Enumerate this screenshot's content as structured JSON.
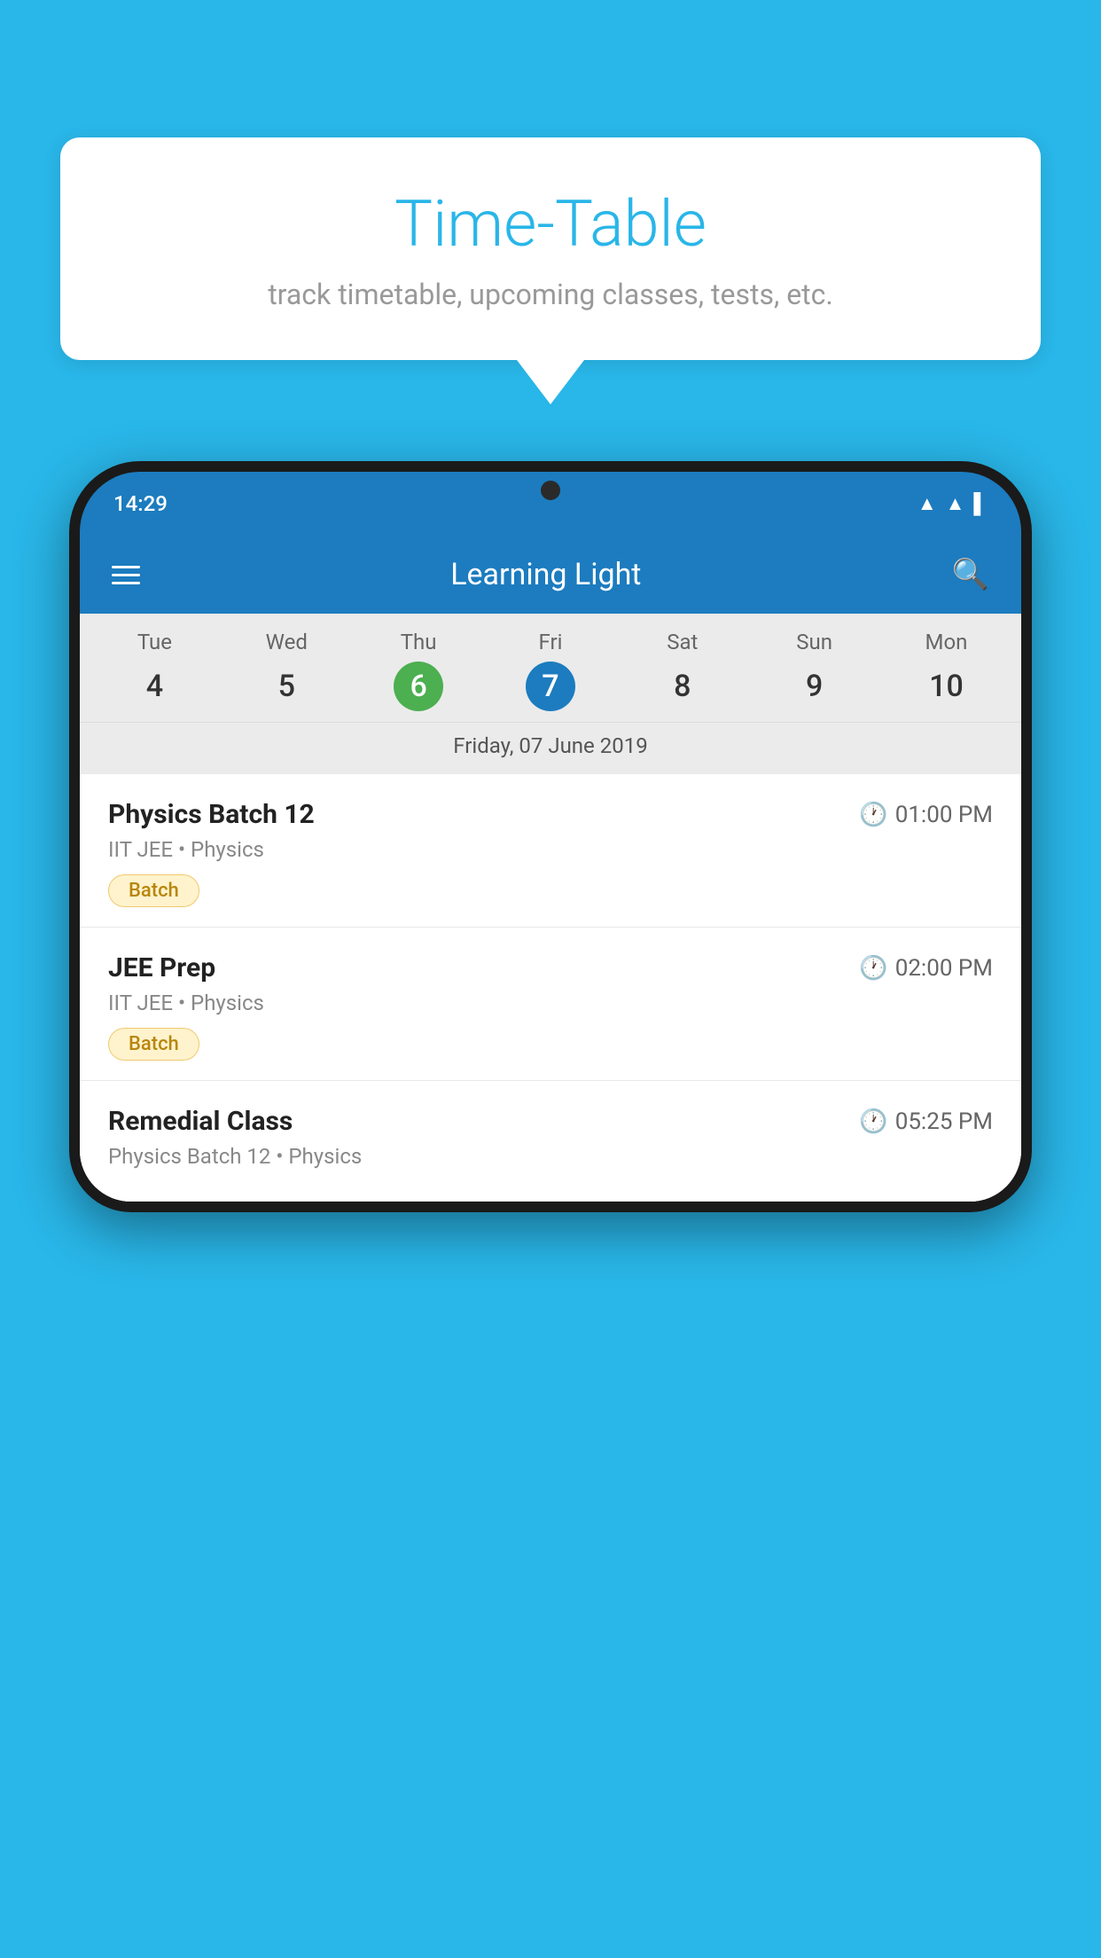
{
  "background_color": "#29b6e8",
  "speech_bubble": {
    "title": "Time-Table",
    "subtitle": "track timetable, upcoming classes, tests, etc."
  },
  "phone": {
    "status_bar": {
      "time": "14:29"
    },
    "app_header": {
      "title": "Learning Light"
    },
    "calendar": {
      "days": [
        {
          "name": "Tue",
          "num": "4",
          "state": "normal"
        },
        {
          "name": "Wed",
          "num": "5",
          "state": "normal"
        },
        {
          "name": "Thu",
          "num": "6",
          "state": "today"
        },
        {
          "name": "Fri",
          "num": "7",
          "state": "selected"
        },
        {
          "name": "Sat",
          "num": "8",
          "state": "normal"
        },
        {
          "name": "Sun",
          "num": "9",
          "state": "normal"
        },
        {
          "name": "Mon",
          "num": "10",
          "state": "normal"
        }
      ],
      "date_label": "Friday, 07 June 2019"
    },
    "classes": [
      {
        "name": "Physics Batch 12",
        "time": "01:00 PM",
        "meta": "IIT JEE • Physics",
        "tag": "Batch"
      },
      {
        "name": "JEE Prep",
        "time": "02:00 PM",
        "meta": "IIT JEE • Physics",
        "tag": "Batch"
      },
      {
        "name": "Remedial Class",
        "time": "05:25 PM",
        "meta": "Physics Batch 12 • Physics",
        "tag": ""
      }
    ]
  }
}
